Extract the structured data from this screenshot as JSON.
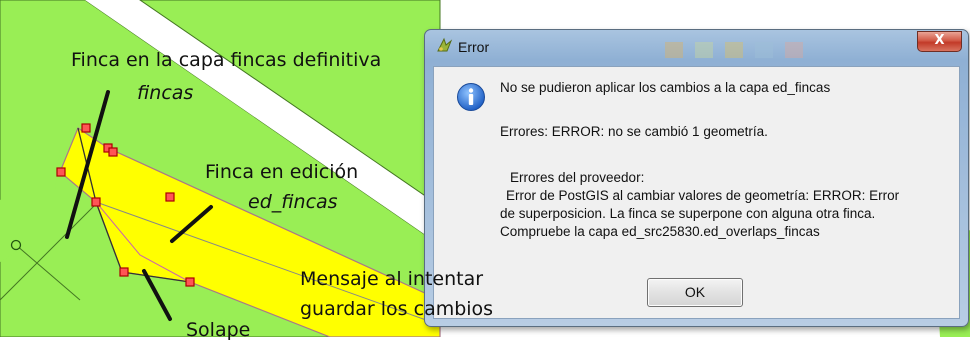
{
  "annotations": {
    "finca_definitiva": "Finca en la capa fincas definitiva",
    "fincas_layer": "fincas",
    "finca_edicion": "Finca en edición",
    "ed_fincas_layer": "ed_fincas",
    "mensaje_line1": "Mensaje al intentar",
    "mensaje_line2": "guardar los cambios",
    "solape": "Solape"
  },
  "dialog": {
    "title": "Error",
    "close_label": "X",
    "message": "No se pudieron aplicar los cambios a la capa ed_fincas",
    "errors": "Errores: ERROR: no se cambió 1 geometría.",
    "provider_header": "Errores del proveedor:",
    "provider_line1": "Error de PostGIS al cambiar valores de geometría: ERROR:  Error",
    "provider_line2": "de superposicion. La finca se superpone con alguna otra finca.",
    "provider_line3": "Compruebe la capa ed_src25830.ed_overlaps_fincas",
    "ok_label": "OK"
  },
  "colors": {
    "parcel_green": "#99ee55",
    "parcel_yellow": "#ffff00",
    "vertex_red": "#dd2222"
  },
  "icons": [
    "info-icon",
    "qgis-icon",
    "close-icon"
  ]
}
